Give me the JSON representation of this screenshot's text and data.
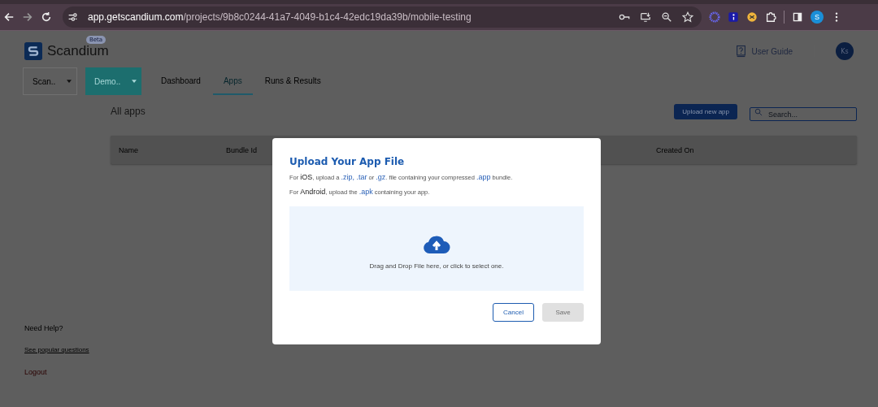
{
  "browser": {
    "url_host": "app.getscandium.com",
    "url_path": "/projects/9b8c0244-41a7-4049-b1c4-42edc19da39b/mobile-testing",
    "profile_initial": "S"
  },
  "header": {
    "brand": "Scandium",
    "badge": "Beta",
    "user_guide": "User Guide",
    "avatar": "Ks"
  },
  "nav": {
    "dropdowns": [
      {
        "label": "Scan..",
        "kind": "outlined"
      },
      {
        "label": "Demo..",
        "kind": "filled"
      }
    ],
    "tabs": [
      {
        "label": "Dashboard",
        "selected": false
      },
      {
        "label": "Apps",
        "selected": true
      },
      {
        "label": "Runs & Results",
        "selected": false
      }
    ]
  },
  "content": {
    "title": "All apps",
    "upload_button": "Upload new app",
    "search": {
      "placeholder": "Search..."
    },
    "table": {
      "columns": [
        "Name",
        "Bundle Id",
        "Created On"
      ]
    }
  },
  "sidebar_footer": {
    "help": "Need Help?",
    "questions_link": "See popular questions",
    "logout": "Logout"
  },
  "dialog": {
    "title": "Upload Your App File",
    "paragraphs": [
      [
        {
          "text": "For ",
          "kind": "plain"
        },
        {
          "text": "iOS",
          "kind": "term"
        },
        {
          "text": ", upload a ",
          "kind": "plain"
        },
        {
          "text": ".zip, .tar",
          "kind": "ext"
        },
        {
          "text": " or ",
          "kind": "plain"
        },
        {
          "text": ".gz",
          "kind": "ext"
        },
        {
          "text": ". file containing your compressed ",
          "kind": "plain"
        },
        {
          "text": ".app",
          "kind": "ext"
        },
        {
          "text": " bundle.",
          "kind": "plain"
        }
      ],
      [
        {
          "text": "For ",
          "kind": "plain"
        },
        {
          "text": "Android",
          "kind": "term"
        },
        {
          "text": ", upload the ",
          "kind": "plain"
        },
        {
          "text": ".apk",
          "kind": "ext"
        },
        {
          "text": " containing your app.",
          "kind": "plain"
        }
      ]
    ],
    "dropzone_text": "Drag and Drop File here, or click to select one.",
    "buttons": [
      {
        "label": "Cancel",
        "disabled": false
      },
      {
        "label": "Save",
        "disabled": true
      }
    ]
  }
}
